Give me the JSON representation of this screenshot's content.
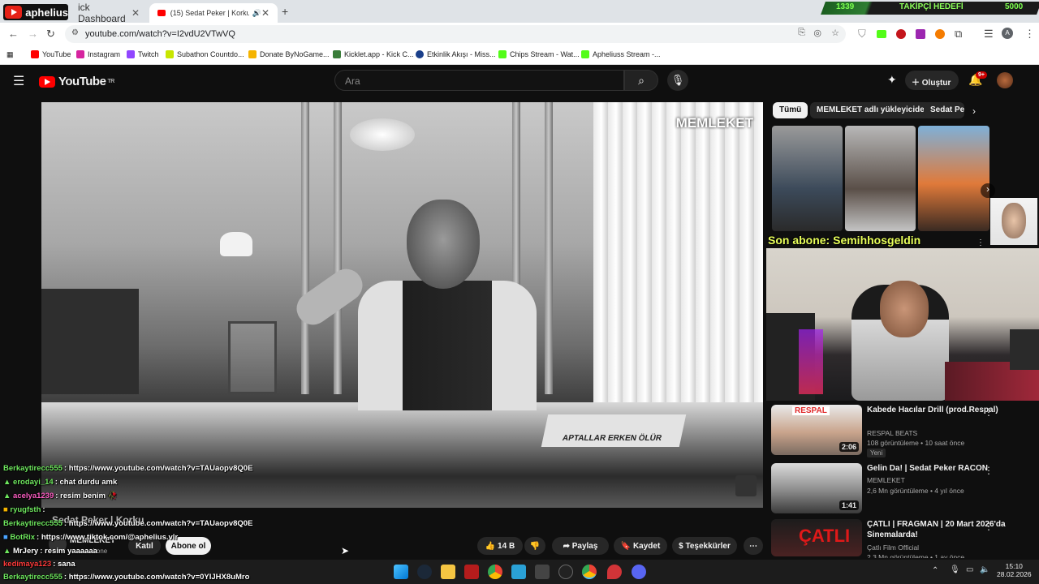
{
  "browser": {
    "stream_logo_text": "aphelius",
    "tabs": [
      {
        "label": "ick Dashboard",
        "close": "✕"
      },
      {
        "label": "(15) Sedat Peker | Korku - Y",
        "close": "✕"
      }
    ],
    "new_tab": "+",
    "goal": {
      "current": "1339",
      "label": "TAKİPÇİ HEDEFİ",
      "target": "5000",
      "progress": 0.268
    },
    "url": "youtube.com/watch?v=I2vdU2VTwVQ",
    "profile_initial": "A",
    "bookmarks": [
      {
        "label": "YouTube",
        "color": "#ff0000"
      },
      {
        "label": "Instagram",
        "color": "#d6249f"
      },
      {
        "label": "Twitch",
        "color": "#9146ff"
      },
      {
        "label": "Subathon Countdo...",
        "color": "#c8e600"
      },
      {
        "label": "Donate ByNoGame...",
        "color": "#f5b400"
      },
      {
        "label": "Kicklet.app - Kick C...",
        "color": "#3a7d3a"
      },
      {
        "label": "Etkinlik Akışı - Miss...",
        "color": "#1a3f8a"
      },
      {
        "label": "Chips Stream - Wat...",
        "color": "#53fc18"
      },
      {
        "label": "Apheliuss Stream -...",
        "color": "#53fc18"
      }
    ]
  },
  "youtube": {
    "logo_text": "YouTube",
    "logo_region": "TR",
    "search_placeholder": "Ara",
    "create_label": "Oluştur",
    "notif_count": "9+",
    "video": {
      "watermark": "MEMLEKET",
      "book_title": "APTALLAR ERKEN ÖLÜR",
      "title_fragment": "Sedat Peker | Korku",
      "channel": "MEMLEKET",
      "subs": "abone",
      "join_label": "Katıl",
      "subscribe_label": "Abone ol",
      "likes": "14 B",
      "share_label": "Paylaş",
      "save_label": "Kaydet",
      "thanks_label": "Teşekkürler"
    },
    "chips": [
      "Tümü",
      "MEMLEKET adlı yükleyiciden",
      "Sedat Pe"
    ],
    "recommendations": [
      {
        "title": "Kabede Hacılar Drill (prod.Respal)",
        "channel": "RESPAL BEATS",
        "meta": "108 görüntüleme • 10 saat önce",
        "badge": "Yeni",
        "duration": "2:06",
        "thumb_label": "RESPAL"
      },
      {
        "title": "Gelin Da! | Sedat Peker RACON",
        "channel": "MEMLEKET",
        "meta": "2,6 Mn görüntüleme • 4 yıl önce",
        "badge": "",
        "duration": "1:41",
        "thumb_label": ""
      },
      {
        "title": "ÇATLI | FRAGMAN | 20 Mart 2026'da Sinemalarda!",
        "channel": "Çatlı Film Official",
        "meta": "2,3 Mn görüntüleme • 1 ay önce",
        "badge": "",
        "duration": "",
        "thumb_label": "ÇATLI"
      }
    ]
  },
  "stream_overlay": {
    "last_sub": "Son abone: Semihhosgeldin",
    "chat": [
      {
        "user": "Berkaytirecc555",
        "msg": ": https://www.youtube.com/watch?v=TAUaopv8Q0E",
        "color": "#6fe85f"
      },
      {
        "user": "erodayi_14",
        "msg": ": chat durdu amk",
        "color": "#6fe85f"
      },
      {
        "user": "acelya1239",
        "msg": ": resim benim",
        "color": "#ff5ec4"
      },
      {
        "user": "ryugfsth",
        "msg": ":",
        "color": "#6fe85f"
      },
      {
        "user": "Berkaytirecc555",
        "msg": ": https://www.youtube.com/watch?v=TAUaopv8Q0E",
        "color": "#6fe85f"
      },
      {
        "user": "BotRix",
        "msg": ": https://www.tiktok.com/@aphelius.vlr",
        "color": "#6fe85f"
      },
      {
        "user": "MrJery",
        "msg": ": resim yaaaaaa",
        "color": "#ffffff"
      },
      {
        "user": "kedimaya123",
        "msg": ": sana",
        "color": "#ff3b3b"
      },
      {
        "user": "Berkaytirecc555",
        "msg": ": https://www.youtube.com/watch?v=0YIJHX8uMro",
        "color": "#6fe85f"
      }
    ]
  },
  "taskbar": {
    "time": "15:10",
    "date": "28.02.2026"
  }
}
